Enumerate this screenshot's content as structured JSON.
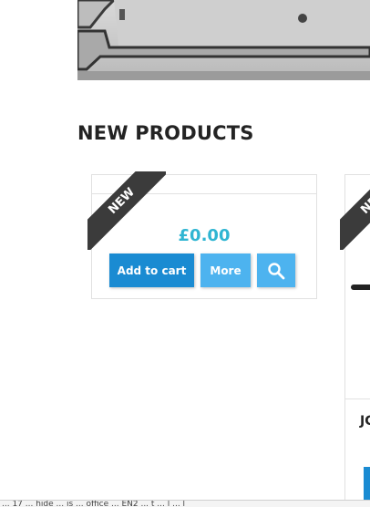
{
  "section": {
    "title": "NEW PRODUCTS"
  },
  "products": [
    {
      "badge": "NEW",
      "price": "£0.00",
      "add_to_cart_label": "Add to cart",
      "more_label": "More",
      "search_icon": "magnifier-icon"
    },
    {
      "badge": "NEW",
      "name_partial": "JC"
    }
  ],
  "status_bar": {
    "text": "... 17 ... hide ... is ... office ... EN2 ... t ... l ... l"
  },
  "colors": {
    "ribbon": "#3b3b3b",
    "price": "#2fb5d2",
    "primary_button": "#1a8bd2",
    "secondary_button": "#4db3ef",
    "title": "#232323"
  }
}
